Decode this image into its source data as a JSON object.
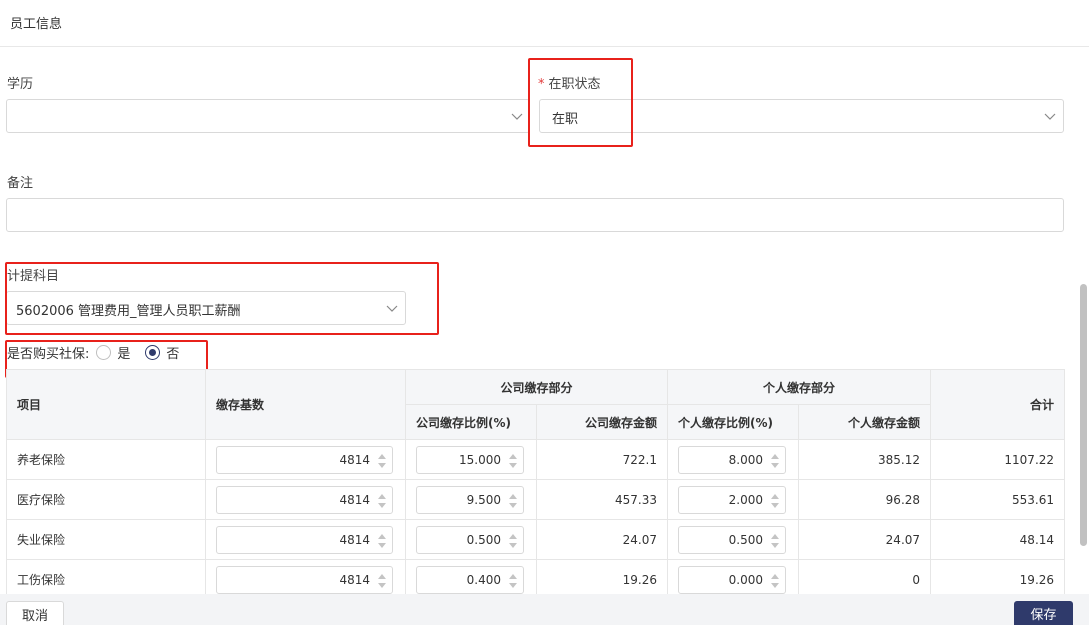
{
  "header": {
    "title": "员工信息"
  },
  "form": {
    "education": {
      "label": "学历",
      "value": ""
    },
    "status": {
      "label": "在职状态",
      "required_mark": "*",
      "value": "在职"
    },
    "remark": {
      "label": "备注",
      "value": ""
    },
    "account": {
      "label": "计提科目",
      "value": "5602006 管理费用_管理人员职工薪酬"
    },
    "social": {
      "label": "是否购买社保:",
      "options": [
        "是",
        "否"
      ],
      "selected": "否"
    }
  },
  "table": {
    "headers": {
      "item": "项目",
      "base": "缴存基数",
      "company_group": "公司缴存部分",
      "personal_group": "个人缴存部分",
      "company_ratio": "公司缴存比例(%)",
      "company_amount": "公司缴存金额",
      "personal_ratio": "个人缴存比例(%)",
      "personal_amount": "个人缴存金额",
      "total": "合计"
    },
    "rows": [
      {
        "item": "养老保险",
        "base": "4814",
        "company_ratio": "15.000",
        "company_amount": "722.1",
        "personal_ratio": "8.000",
        "personal_amount": "385.12",
        "total": "1107.22"
      },
      {
        "item": "医疗保险",
        "base": "4814",
        "company_ratio": "9.500",
        "company_amount": "457.33",
        "personal_ratio": "2.000",
        "personal_amount": "96.28",
        "total": "553.61"
      },
      {
        "item": "失业保险",
        "base": "4814",
        "company_ratio": "0.500",
        "company_amount": "24.07",
        "personal_ratio": "0.500",
        "personal_amount": "24.07",
        "total": "48.14"
      },
      {
        "item": "工伤保险",
        "base": "4814",
        "company_ratio": "0.400",
        "company_amount": "19.26",
        "personal_ratio": "0.000",
        "personal_amount": "0",
        "total": "19.26"
      }
    ]
  },
  "footer": {
    "cancel_label": "取消",
    "save_label": "保存"
  },
  "colors": {
    "primary": "#2f3a6b",
    "highlight": "#e8211b",
    "required": "#e23b3b"
  }
}
